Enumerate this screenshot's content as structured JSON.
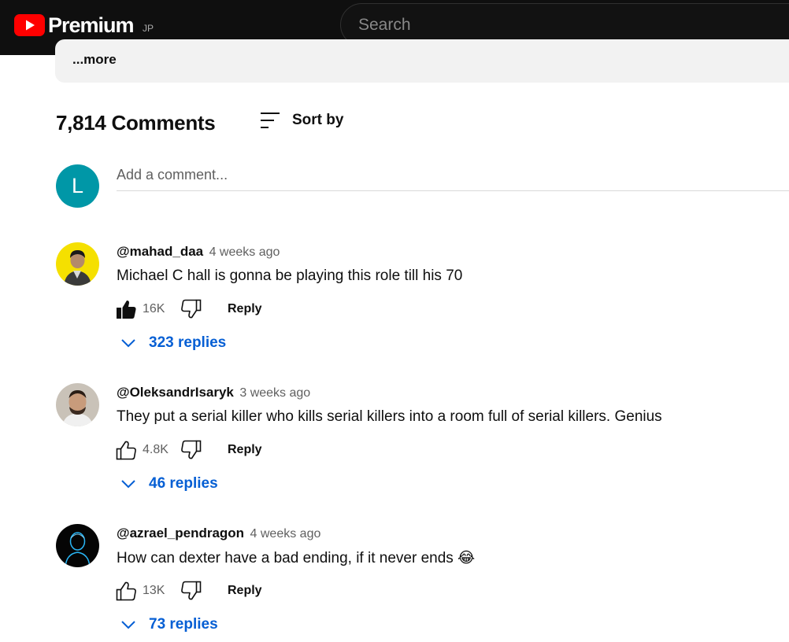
{
  "header": {
    "logo_text": "Premium",
    "region": "JP",
    "logo_icon": "youtube-play-icon",
    "search_placeholder": "Search"
  },
  "description": {
    "more_label": "...more"
  },
  "comments_header": {
    "count_label": "7,814 Comments",
    "sort_label": "Sort by",
    "sort_icon": "sort-icon"
  },
  "add_comment": {
    "avatar_letter": "L",
    "avatar_color": "#0097a7",
    "placeholder": "Add a comment..."
  },
  "comments": [
    {
      "author": "@mahad_daa",
      "time": "4 weeks ago",
      "text": "Michael C hall is gonna be playing this role till his 70",
      "likes": "16K",
      "liked": true,
      "reply_label": "Reply",
      "replies_label": "323 replies"
    },
    {
      "author": "@OleksandrIsaryk",
      "time": "3 weeks ago",
      "text": "They put a serial killer who kills serial killers into a room full of serial killers. Genius",
      "likes": "4.8K",
      "liked": false,
      "reply_label": "Reply",
      "replies_label": "46 replies"
    },
    {
      "author": "@azrael_pendragon",
      "time": "4 weeks ago",
      "text": "How can dexter have a bad ending, if it never ends 😂",
      "likes": "13K",
      "liked": false,
      "reply_label": "Reply",
      "replies_label": "73 replies"
    }
  ],
  "colors": {
    "header_bg": "#0f0f0f",
    "brand_red": "#ff0000",
    "link_blue": "#065fd4",
    "muted_text": "#606060"
  }
}
